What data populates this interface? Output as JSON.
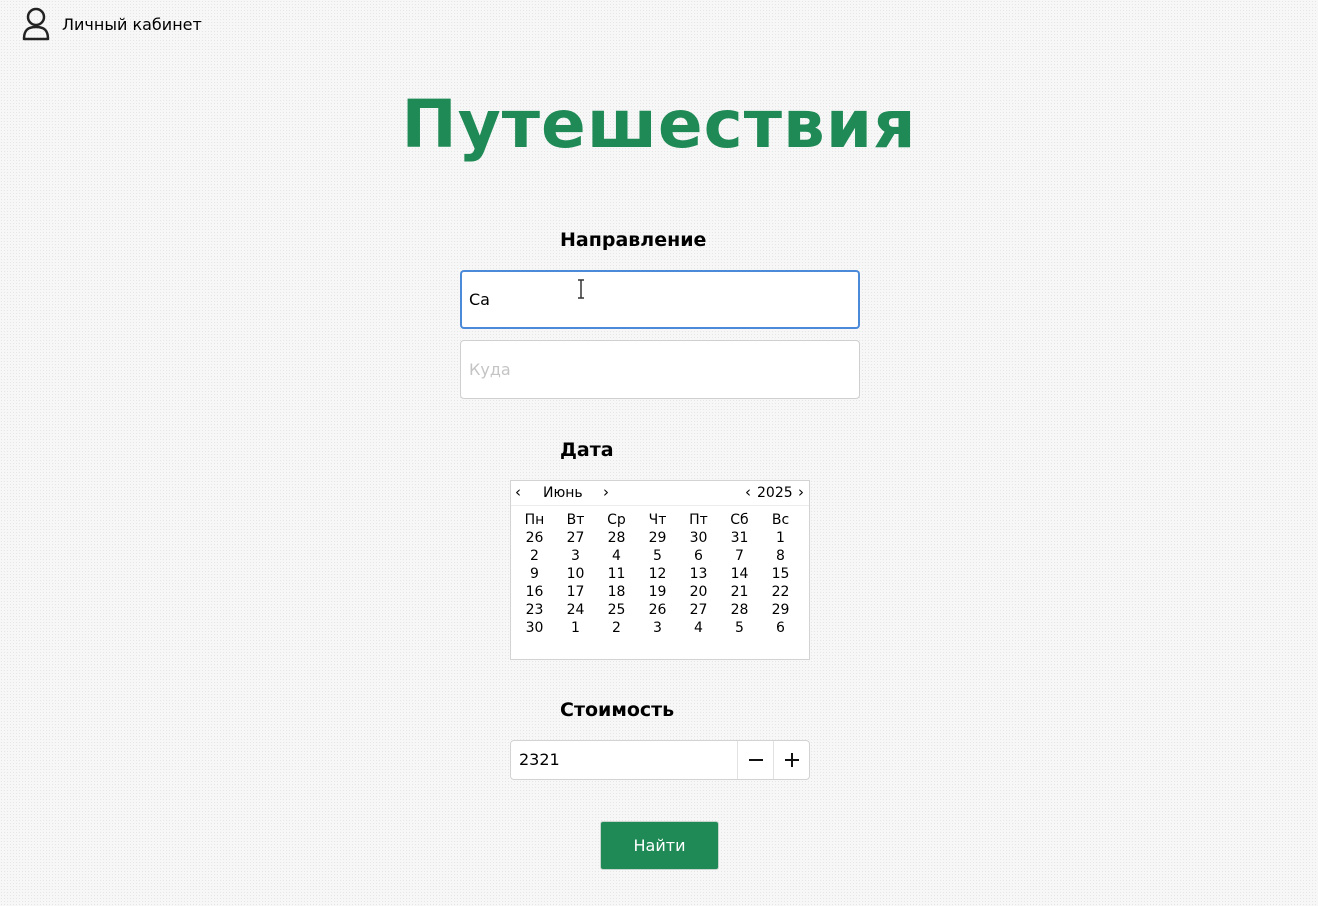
{
  "header": {
    "account_icon": "user-icon",
    "account_label": "Личный кабинет"
  },
  "title": "Путешествия",
  "direction": {
    "label": "Направление",
    "from_value": "Са",
    "to_placeholder": "Куда"
  },
  "date": {
    "label": "Дата",
    "month": "Июнь",
    "year": "2025",
    "weekdays": [
      "Пн",
      "Вт",
      "Ср",
      "Чт",
      "Пт",
      "Сб",
      "Вс"
    ],
    "weeks": [
      [
        "26",
        "27",
        "28",
        "29",
        "30",
        "31",
        "1"
      ],
      [
        "2",
        "3",
        "4",
        "5",
        "6",
        "7",
        "8"
      ],
      [
        "9",
        "10",
        "11",
        "12",
        "13",
        "14",
        "15"
      ],
      [
        "16",
        "17",
        "18",
        "19",
        "20",
        "21",
        "22"
      ],
      [
        "23",
        "24",
        "25",
        "26",
        "27",
        "28",
        "29"
      ],
      [
        "30",
        "1",
        "2",
        "3",
        "4",
        "5",
        "6"
      ]
    ]
  },
  "cost": {
    "label": "Стоимость",
    "value": "2321"
  },
  "search_button": "Найти",
  "colors": {
    "accent": "#1f8a56",
    "focus_border": "#4a8ad8"
  }
}
